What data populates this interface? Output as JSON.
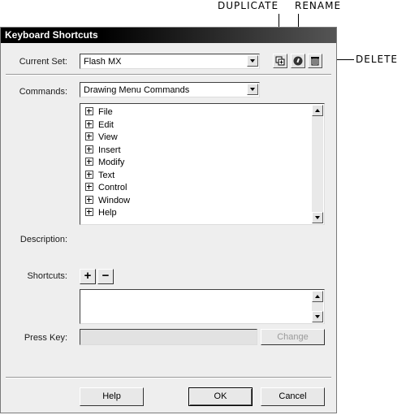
{
  "callouts": {
    "duplicate": "DUPLICATE",
    "rename": "RENAME",
    "delete": "DELETE"
  },
  "dialog": {
    "title": "Keyboard Shortcuts",
    "current_set_label": "Current Set:",
    "current_set_value": "Flash MX",
    "commands_label": "Commands:",
    "commands_value": "Drawing Menu Commands",
    "tree_items": [
      "File",
      "Edit",
      "View",
      "Insert",
      "Modify",
      "Text",
      "Control",
      "Window",
      "Help"
    ],
    "description_label": "Description:",
    "shortcuts_label": "Shortcuts:",
    "add_symbol": "+",
    "remove_symbol": "−",
    "press_key_label": "Press Key:",
    "change_label": "Change",
    "help_label": "Help",
    "ok_label": "OK",
    "cancel_label": "Cancel"
  },
  "icons": {
    "duplicate": "duplicate-icon",
    "rename": "rename-icon",
    "delete": "trash-icon"
  }
}
